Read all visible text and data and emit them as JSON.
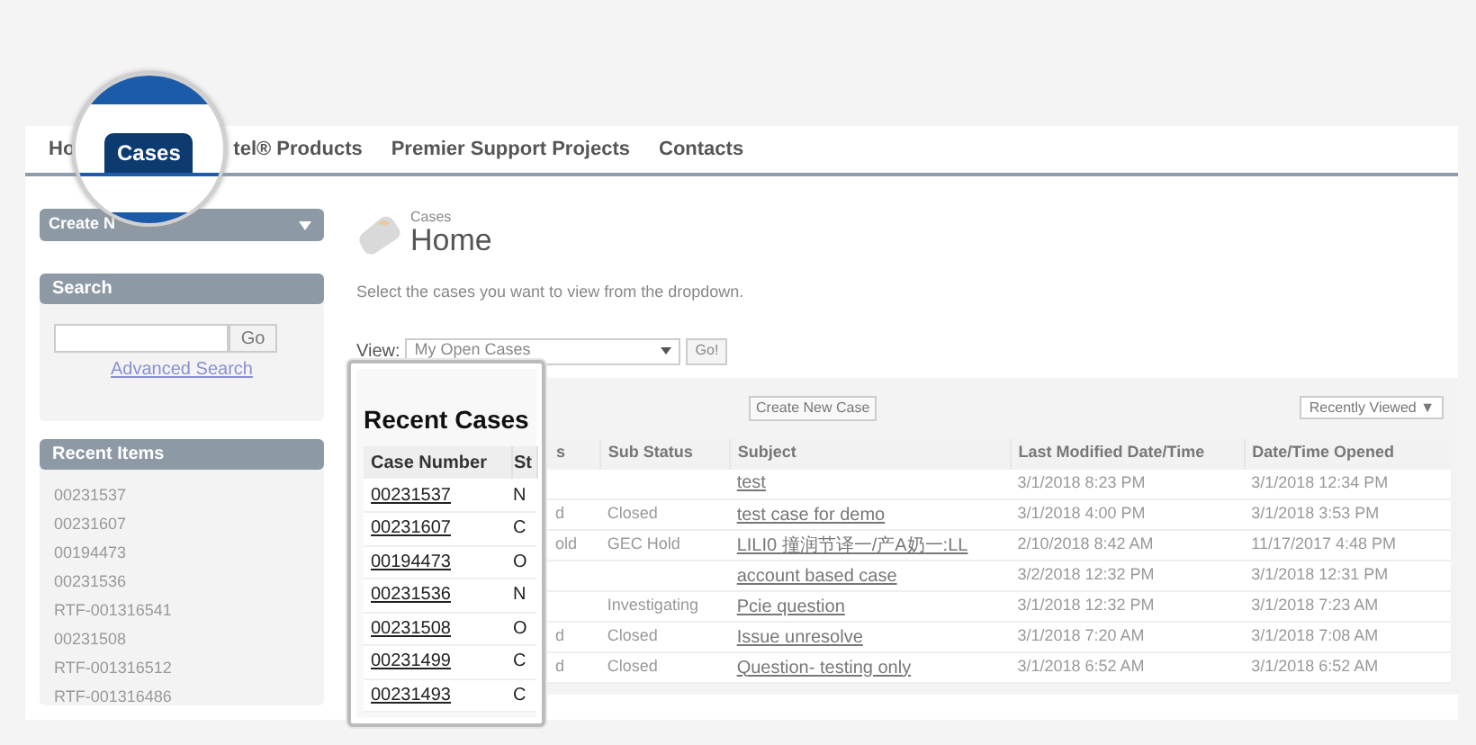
{
  "tabs": [
    {
      "label": "Ho",
      "selected": false
    },
    {
      "label": "Cases",
      "selected": true
    },
    {
      "label": "tel® Products",
      "selected": false
    },
    {
      "label": "Premier Support Projects",
      "selected": false
    },
    {
      "label": "Contacts",
      "selected": false
    }
  ],
  "sidebar": {
    "create_new": "Create N",
    "search": {
      "title": "Search",
      "button": "Go",
      "link": "Advanced Search"
    },
    "recent_items": {
      "title": "Recent Items",
      "items": [
        "00231537",
        "00231607",
        "00194473",
        "00231536",
        "RTF-001316541",
        "00231508",
        "RTF-001316512",
        "RTF-001316486"
      ]
    }
  },
  "header": {
    "breadcrumb": "Cases",
    "title": "Home"
  },
  "intro": "Select the cases you want to view from the dropdown.",
  "view": {
    "label": "View:",
    "value": "My Open Cases",
    "button": "Go!"
  },
  "recent_cases": {
    "create_button": "Create New Case",
    "sort": "Recently Viewed ▼",
    "columns": [
      "s",
      "Sub Status",
      "Subject",
      "Last Modified Date/Time",
      "Date/Time Opened"
    ],
    "rows": [
      [
        "",
        "",
        "test",
        "3/1/2018 8:23 PM",
        "3/1/2018 12:34 PM"
      ],
      [
        "d",
        "Closed",
        "test case for demo",
        "3/1/2018 4:00 PM",
        "3/1/2018 3:53 PM"
      ],
      [
        "old",
        "GEC Hold",
        "LILI0 撞润节译一/产A奶一:LL",
        "2/10/2018 8:42 AM",
        "11/17/2017 4:48 PM"
      ],
      [
        "",
        "",
        "account based case",
        "3/2/2018 12:32 PM",
        "3/1/2018 12:31 PM"
      ],
      [
        "",
        "Investigating",
        "Pcie question",
        "3/1/2018 12:32 PM",
        "3/1/2018 7:23 AM"
      ],
      [
        "d",
        "Closed",
        "Issue unresolve",
        "3/1/2018 7:20 AM",
        "3/1/2018 7:08 AM"
      ],
      [
        "d",
        "Closed",
        "Question- testing only",
        "3/1/2018 6:52 AM",
        "3/1/2018 6:52 AM"
      ]
    ]
  },
  "callout": {
    "title": "Recent Cases",
    "columns": [
      "Case Number",
      "St"
    ],
    "rows": [
      [
        "00231537",
        "N"
      ],
      [
        "00231607",
        "C"
      ],
      [
        "00194473",
        "O"
      ],
      [
        "00231536",
        "N"
      ],
      [
        "00231508",
        "O"
      ],
      [
        "00231499",
        "C"
      ],
      [
        "00231493",
        "C"
      ]
    ]
  }
}
